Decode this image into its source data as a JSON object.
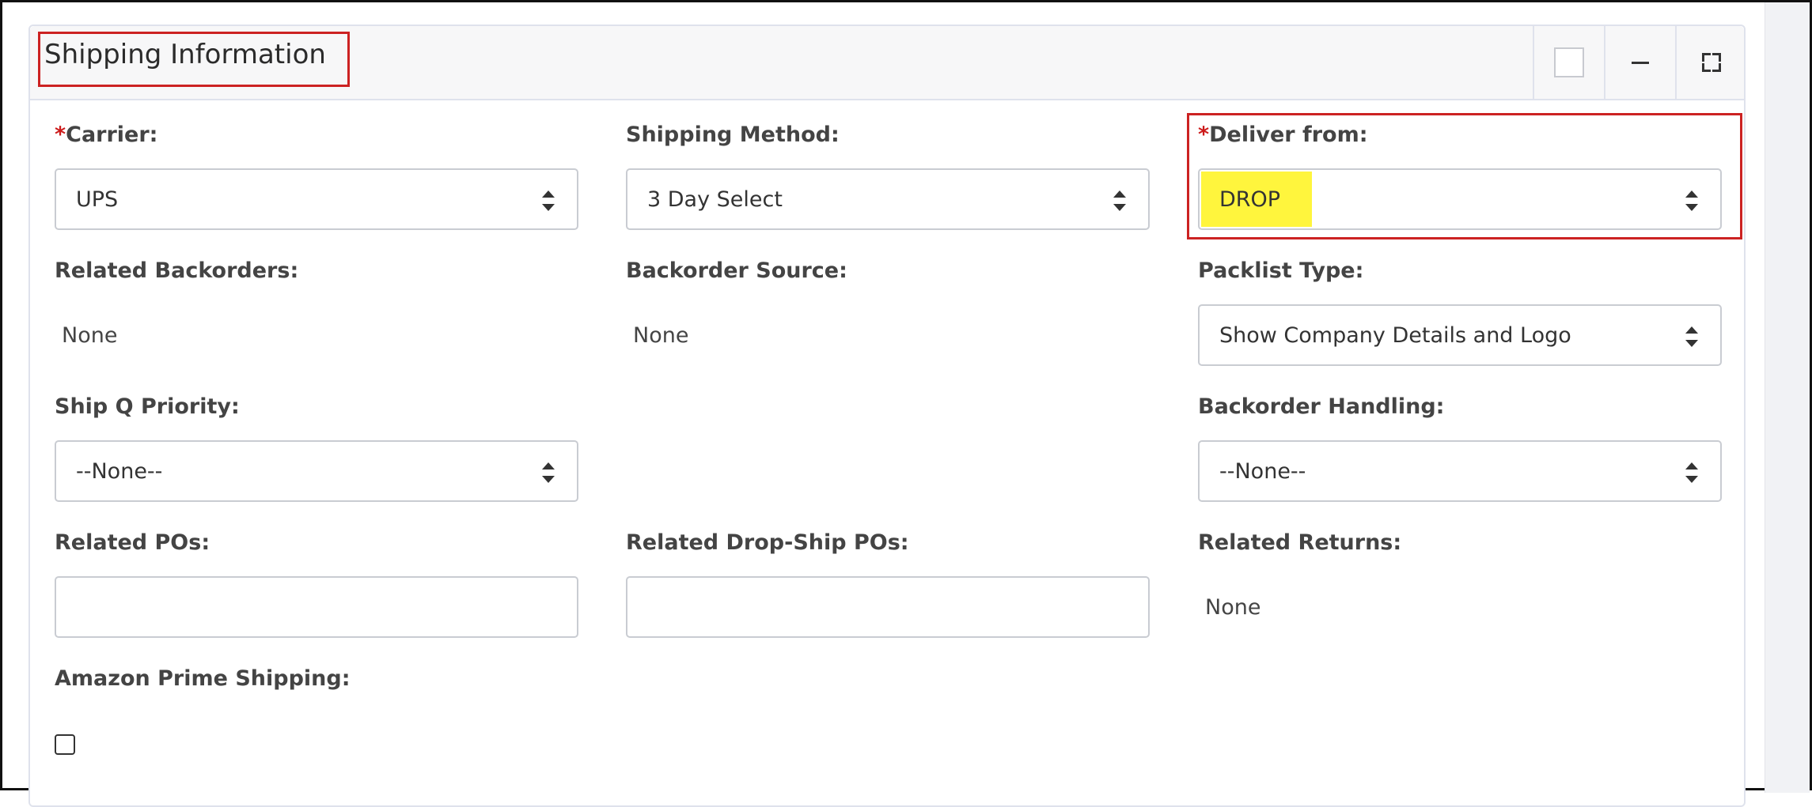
{
  "panel": {
    "title": "Shipping Information"
  },
  "fields": {
    "carrier": {
      "required_mark": "*",
      "label": "Carrier:",
      "value": "UPS"
    },
    "shipping_method": {
      "label": "Shipping Method:",
      "value": "3 Day Select"
    },
    "deliver_from": {
      "required_mark": "*",
      "label": "Deliver from:",
      "value": "DROP"
    },
    "related_backorders": {
      "label": "Related Backorders:",
      "value": "None"
    },
    "backorder_source": {
      "label": "Backorder Source:",
      "value": "None"
    },
    "packlist_type": {
      "label": "Packlist Type:",
      "value": "Show Company Details and Logo"
    },
    "ship_q_priority": {
      "label": "Ship Q Priority:",
      "value": "--None--"
    },
    "backorder_handling": {
      "label": "Backorder Handling:",
      "value": "--None--"
    },
    "related_pos": {
      "label": "Related POs:",
      "value": ""
    },
    "related_drop_ship_pos": {
      "label": "Related Drop-Ship POs:",
      "value": ""
    },
    "related_returns": {
      "label": "Related Returns:",
      "value": "None"
    },
    "amazon_prime_shipping": {
      "label": "Amazon Prime Shipping:",
      "checked": false
    }
  },
  "icons": {
    "header_square": "square-icon",
    "header_minimize": "minus-icon",
    "header_expand": "expand-icon",
    "select_arrows": "sort-arrows-icon"
  },
  "colors": {
    "required": "#cc1a1a",
    "annotation_box": "#cc2222",
    "highlight": "#fff53d"
  }
}
